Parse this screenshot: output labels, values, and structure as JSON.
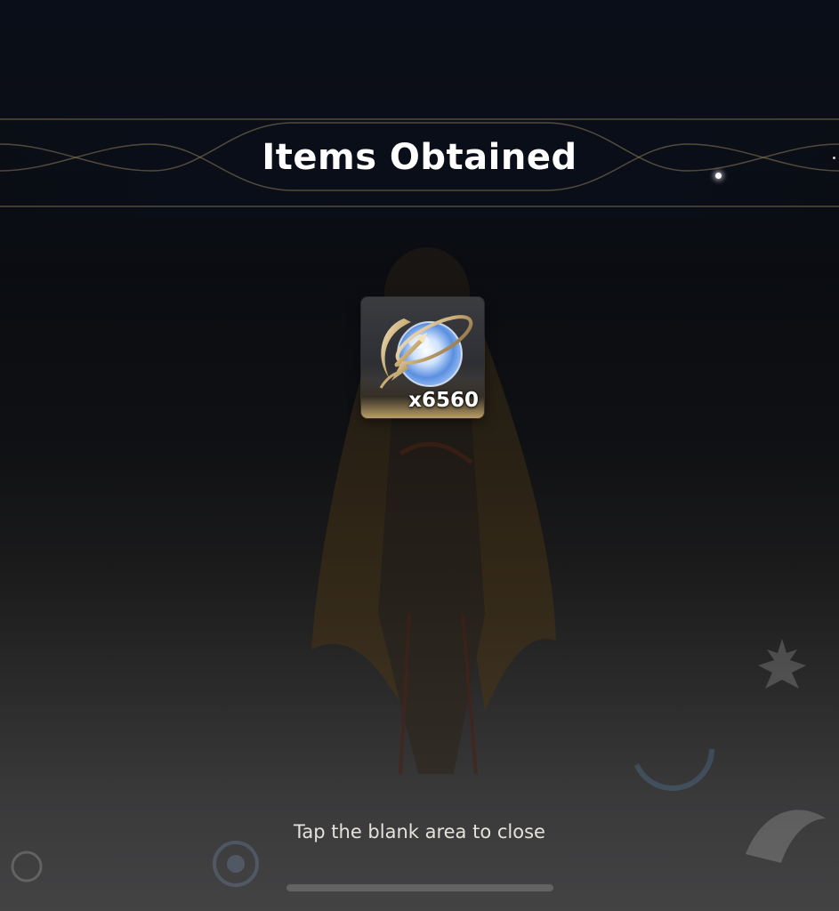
{
  "dialog": {
    "title": "Items Obtained",
    "close_hint": "Tap the blank area to close"
  },
  "items": [
    {
      "icon": "moon-orb-currency-icon",
      "count": "x6560"
    }
  ],
  "colors": {
    "title_text": "#ffffff",
    "hint_text": "#e6e2da",
    "banner_line": "#8f7c5a",
    "card_rarity_glow": "#b59b6a"
  }
}
